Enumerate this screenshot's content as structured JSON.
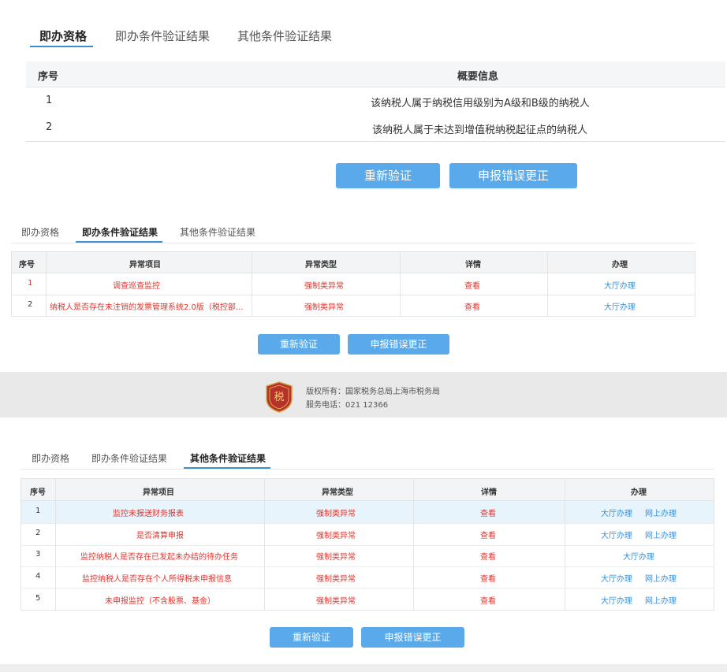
{
  "section1": {
    "tabs": [
      "即办资格",
      "即办条件验证结果",
      "其他条件验证结果"
    ],
    "columns": [
      "序号",
      "概要信息"
    ],
    "rows": [
      {
        "no": "1",
        "info": "该纳税人属于纳税信用级别为A级和B级的纳税人"
      },
      {
        "no": "2",
        "info": "该纳税人属于未达到增值税纳税起征点的纳税人"
      }
    ],
    "buttons": {
      "reverify": "重新验证",
      "correct": "申报错误更正"
    }
  },
  "section2": {
    "tabs": [
      "即办资格",
      "即办条件验证结果",
      "其他条件验证结果"
    ],
    "columns": [
      "序号",
      "异常项目",
      "异常类型",
      "详情",
      "办理"
    ],
    "rows": [
      {
        "no": "1",
        "item": "调查巡查监控",
        "type": "强制类异常",
        "detail": "查看",
        "handle": "大厅办理"
      },
      {
        "no": "2",
        "item": "纳税人是否存在未注销的发票管理系统2.0版（税控部...",
        "type": "强制类异常",
        "detail": "查看",
        "handle": "大厅办理"
      }
    ],
    "buttons": {
      "reverify": "重新验证",
      "correct": "申报错误更正"
    }
  },
  "footer": {
    "copyright": "版权所有：国家税务总局上海市税务局",
    "phone": "服务电话：021 12366",
    "logo_text": "税"
  },
  "section3": {
    "tabs": [
      "即办资格",
      "即办条件验证结果",
      "其他条件验证结果"
    ],
    "columns": [
      "序号",
      "异常项目",
      "异常类型",
      "详情",
      "办理"
    ],
    "rows": [
      {
        "no": "1",
        "item": "监控未报送财务报表",
        "type": "强制类异常",
        "detail": "查看",
        "hall": "大厅办理",
        "online": "网上办理"
      },
      {
        "no": "2",
        "item": "是否清算申报",
        "type": "强制类异常",
        "detail": "查看",
        "hall": "大厅办理",
        "online": "网上办理"
      },
      {
        "no": "3",
        "item": "监控纳税人是否存在已发起未办结的待办任务",
        "type": "强制类异常",
        "detail": "查看",
        "hall": "大厅办理",
        "online": ""
      },
      {
        "no": "4",
        "item": "监控纳税人是否存在个人所得税未申报信息",
        "type": "强制类异常",
        "detail": "查看",
        "hall": "大厅办理",
        "online": "网上办理"
      },
      {
        "no": "5",
        "item": "未申报监控（不含股票、基金）",
        "type": "强制类异常",
        "detail": "查看",
        "hall": "大厅办理",
        "online": "网上办理"
      }
    ],
    "buttons": {
      "reverify": "重新验证",
      "correct": "申报错误更正"
    }
  },
  "colors": {
    "accent": "#3c8fd4",
    "button": "#5aa9ea",
    "error_red": "#e0342d",
    "highlight_row": "#e8f4fc"
  }
}
